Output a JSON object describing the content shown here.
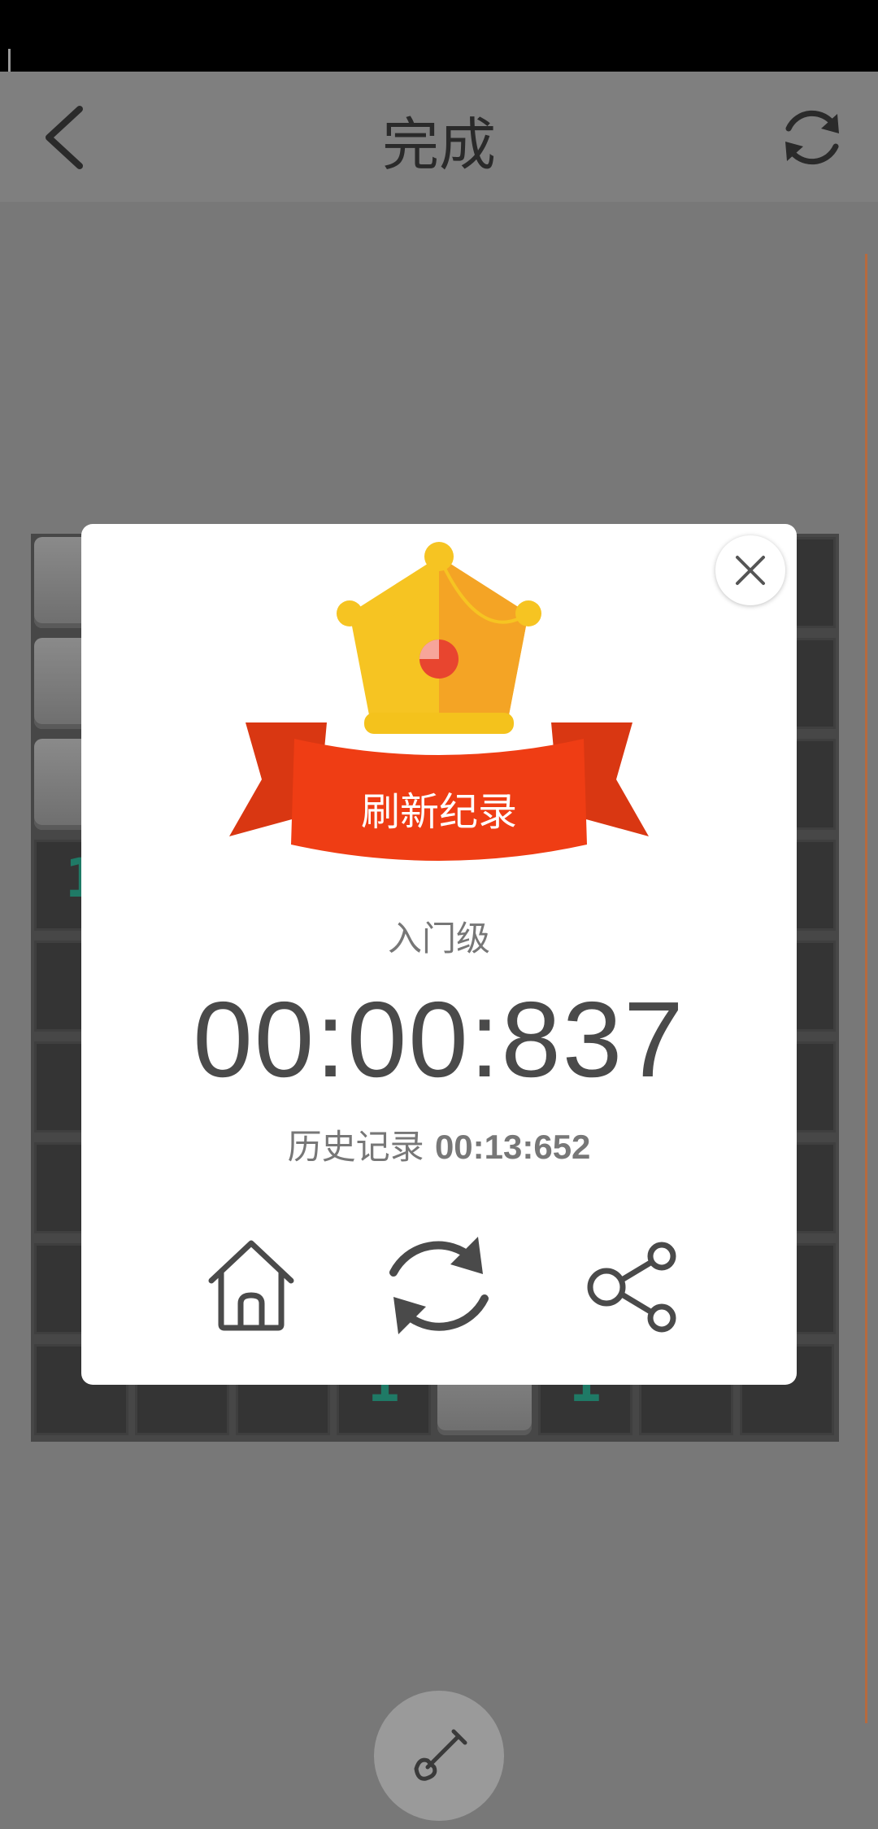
{
  "app_bar": {
    "title": "完成",
    "back_icon": "chevron-left-icon",
    "refresh_icon": "refresh-icon"
  },
  "board": {
    "cols": 8,
    "rows": 9,
    "visible_numbers": {
      "row4_col0": "1",
      "row8_col3": "1",
      "row8_col5": "1"
    }
  },
  "dialog": {
    "badge_text": "刷新纪录",
    "level": "入门级",
    "time": "00:00:837",
    "history_label": "历史记录",
    "history_value": "00:13:652",
    "actions": {
      "home": "home-icon",
      "retry": "refresh-icon",
      "share": "share-icon"
    },
    "close_icon": "close-icon"
  },
  "fab_icon": "shovel-icon",
  "colors": {
    "ribbon": "#ef3d14",
    "crown_gold": "#f6c422",
    "crown_red": "#e8452f",
    "number": "#1f7a66"
  }
}
